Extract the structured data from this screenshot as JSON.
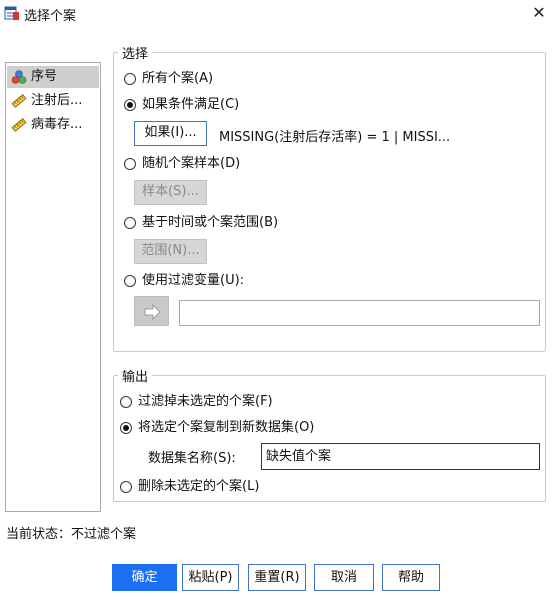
{
  "window": {
    "title": "选择个案",
    "close_glyph": "✕"
  },
  "variables": [
    {
      "label": "序号",
      "icon": "nominal-variable-icon",
      "selected": true
    },
    {
      "label": "注射后...",
      "icon": "scale-variable-icon",
      "selected": false
    },
    {
      "label": "病毒存...",
      "icon": "scale-variable-icon",
      "selected": false
    }
  ],
  "select_group": {
    "title": "选择",
    "options": [
      {
        "label": "所有个案(A)",
        "checked": false
      },
      {
        "label": "如果条件满足(C)",
        "checked": true
      },
      {
        "label": "随机个案样本(D)",
        "checked": false
      },
      {
        "label": "基于时间或个案范围(B)",
        "checked": false
      },
      {
        "label": "使用过滤变量(U):",
        "checked": false
      }
    ],
    "if_button": "如果(I)...",
    "condition": "MISSING(注射后存活率) = 1 | MISSI...",
    "sample_button": "样本(S)...",
    "range_button": "范围(N)...",
    "filter_value": ""
  },
  "output_group": {
    "title": "输出",
    "options": [
      {
        "label": "过滤掉未选定的个案(F)",
        "checked": false
      },
      {
        "label": "将选定个案复制到新数据集(O)",
        "checked": true
      },
      {
        "label": "删除未选定的个案(L)",
        "checked": false
      }
    ],
    "dataset_label": "数据集名称(S):",
    "dataset_value": "缺失值个案"
  },
  "status": "当前状态：不过滤个案",
  "buttons": {
    "ok": "确定",
    "paste": "粘贴(P)",
    "reset": "重置(R)",
    "cancel": "取消",
    "help": "帮助"
  },
  "colors": {
    "accent": "#1a6ff3",
    "button_border": "#4472c4",
    "disabled_bg": "#d6d6d6",
    "selected_bg": "#cfcfcf"
  }
}
